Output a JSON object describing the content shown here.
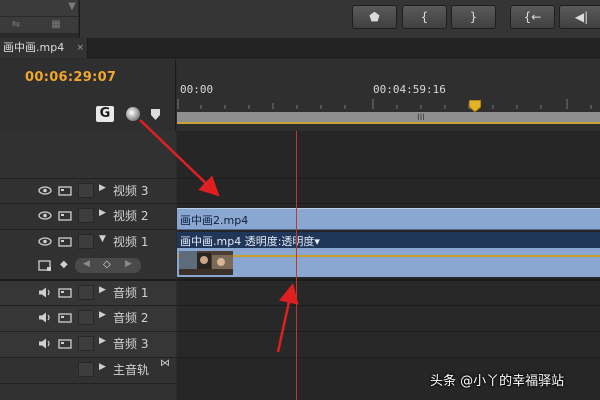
{
  "sequence_tab": {
    "label": "画中画.mp4",
    "close": "×"
  },
  "timecode": "00:06:29:07",
  "ruler": {
    "labels": [
      "00:00",
      "00:04:59:16"
    ]
  },
  "tracks": [
    {
      "name": "视频 3",
      "kind": "video"
    },
    {
      "name": "视频 2",
      "kind": "video"
    },
    {
      "name": "视频 1",
      "kind": "video"
    },
    {
      "name": "音频 1",
      "kind": "audio"
    },
    {
      "name": "音频 2",
      "kind": "audio"
    },
    {
      "name": "音频 3",
      "kind": "audio"
    },
    {
      "name": "主音轨",
      "kind": "master"
    }
  ],
  "clips": {
    "pip_label": "画中画2.mp4",
    "main_label": "画中画.mp4  透明度:透明度▾"
  },
  "work_area_grip": "III",
  "watermark": "头条 @小丫的幸福驿站",
  "colors": {
    "timecode": "#f1a72d",
    "clip": "#8aa7d2",
    "playhead": "#c0392b",
    "annotation_arrow": "#e02020"
  }
}
